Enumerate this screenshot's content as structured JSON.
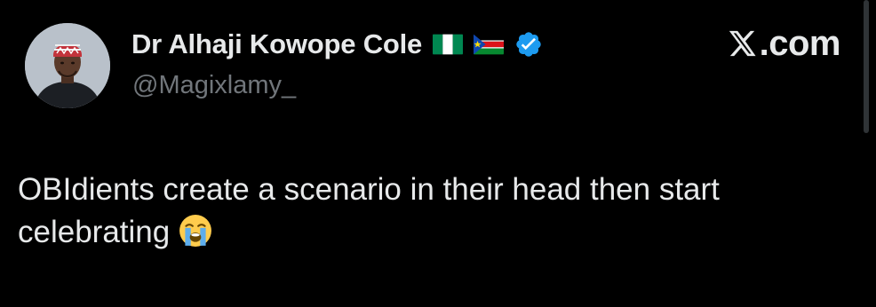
{
  "post": {
    "author": {
      "display_name": "Dr Alhaji Kowope Cole",
      "handle": "@Magixlamy_",
      "avatar_icon": "avatar-person-with-cap",
      "flags": [
        "nigeria-flag-icon",
        "south-sudan-flag-icon"
      ],
      "verified": true,
      "verified_color": "#1d9bf0"
    },
    "body": {
      "text": "OBIdients create a scenario in their head then start celebrating",
      "emoji": "loudly-crying-face-icon"
    }
  },
  "brand": {
    "label": ".com",
    "icon": "x-logo-icon"
  },
  "colors": {
    "background": "#000000",
    "primary_text": "#e7e9ea",
    "secondary_text": "#71767b",
    "accent": "#1d9bf0"
  }
}
